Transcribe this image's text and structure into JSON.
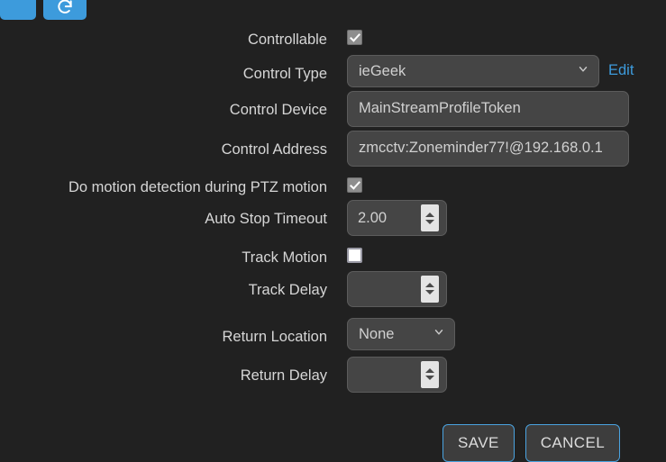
{
  "toolbar": {
    "buttons": [
      {
        "name": "toolbar-button-1",
        "icon": "blank-icon",
        "label": ""
      },
      {
        "name": "toolbar-button-refresh",
        "icon": "refresh-icon",
        "label": ""
      }
    ]
  },
  "form": {
    "rows": {
      "controllable": {
        "label": "Controllable",
        "checked": true
      },
      "control_type": {
        "label": "Control Type",
        "value": "ieGeek",
        "options": [
          "ieGeek"
        ],
        "edit_link": "Edit"
      },
      "control_device": {
        "label": "Control Device",
        "value": "MainStreamProfileToken",
        "placeholder": ""
      },
      "control_address": {
        "label": "Control Address",
        "value": "zmcctv:Zoneminder77!@192.168.0.1",
        "placeholder": ""
      },
      "do_motion_detection": {
        "label": "Do motion detection during PTZ motion",
        "checked": true
      },
      "auto_stop_timeout": {
        "label": "Auto Stop Timeout",
        "value": "2.00",
        "placeholder": ""
      },
      "track_motion": {
        "label": "Track Motion",
        "checked": false
      },
      "track_delay": {
        "label": "Track Delay",
        "value": "",
        "placeholder": ""
      },
      "return_location": {
        "label": "Return Location",
        "value": "None",
        "options": [
          "None"
        ]
      },
      "return_delay": {
        "label": "Return Delay",
        "value": "",
        "placeholder": ""
      }
    }
  },
  "actions": {
    "save_label": "SAVE",
    "cancel_label": "CANCEL"
  },
  "colors": {
    "background": "#212121",
    "accent_blue": "#3d9bdc",
    "button_border_blue": "#4aa3e0",
    "field_bg": "#454545",
    "label_text": "#d6d6d6",
    "input_text": "#d0d0d0"
  }
}
